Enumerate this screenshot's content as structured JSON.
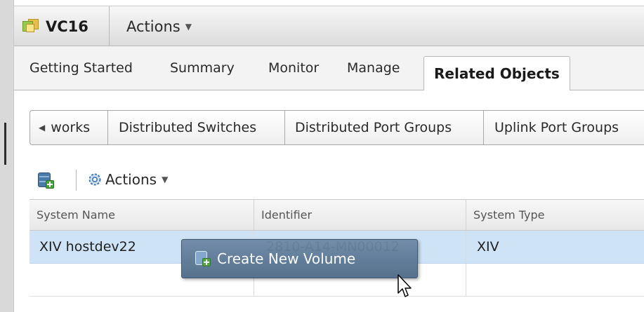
{
  "header": {
    "title": "VC16",
    "actions_label": "Actions"
  },
  "tabs": [
    {
      "label": "Getting Started"
    },
    {
      "label": "Summary"
    },
    {
      "label": "Monitor"
    },
    {
      "label": "Manage"
    },
    {
      "label": "Related Objects",
      "active": true
    }
  ],
  "subtabs": [
    {
      "label": "works"
    },
    {
      "label": "Distributed Switches"
    },
    {
      "label": "Distributed Port Groups"
    },
    {
      "label": "Uplink Port Groups"
    }
  ],
  "toolbar": {
    "actions_label": "Actions"
  },
  "grid": {
    "columns": [
      "System Name",
      "Identifier",
      "System Type"
    ],
    "rows": [
      [
        "XIV hostdev22",
        "2810-A14-MN00012",
        "XIV"
      ]
    ]
  },
  "drag_tooltip": {
    "label": "Create New Volume"
  },
  "colors": {
    "selected_row": "#cfe3f6",
    "tooltip_bg": "#5b7896"
  }
}
